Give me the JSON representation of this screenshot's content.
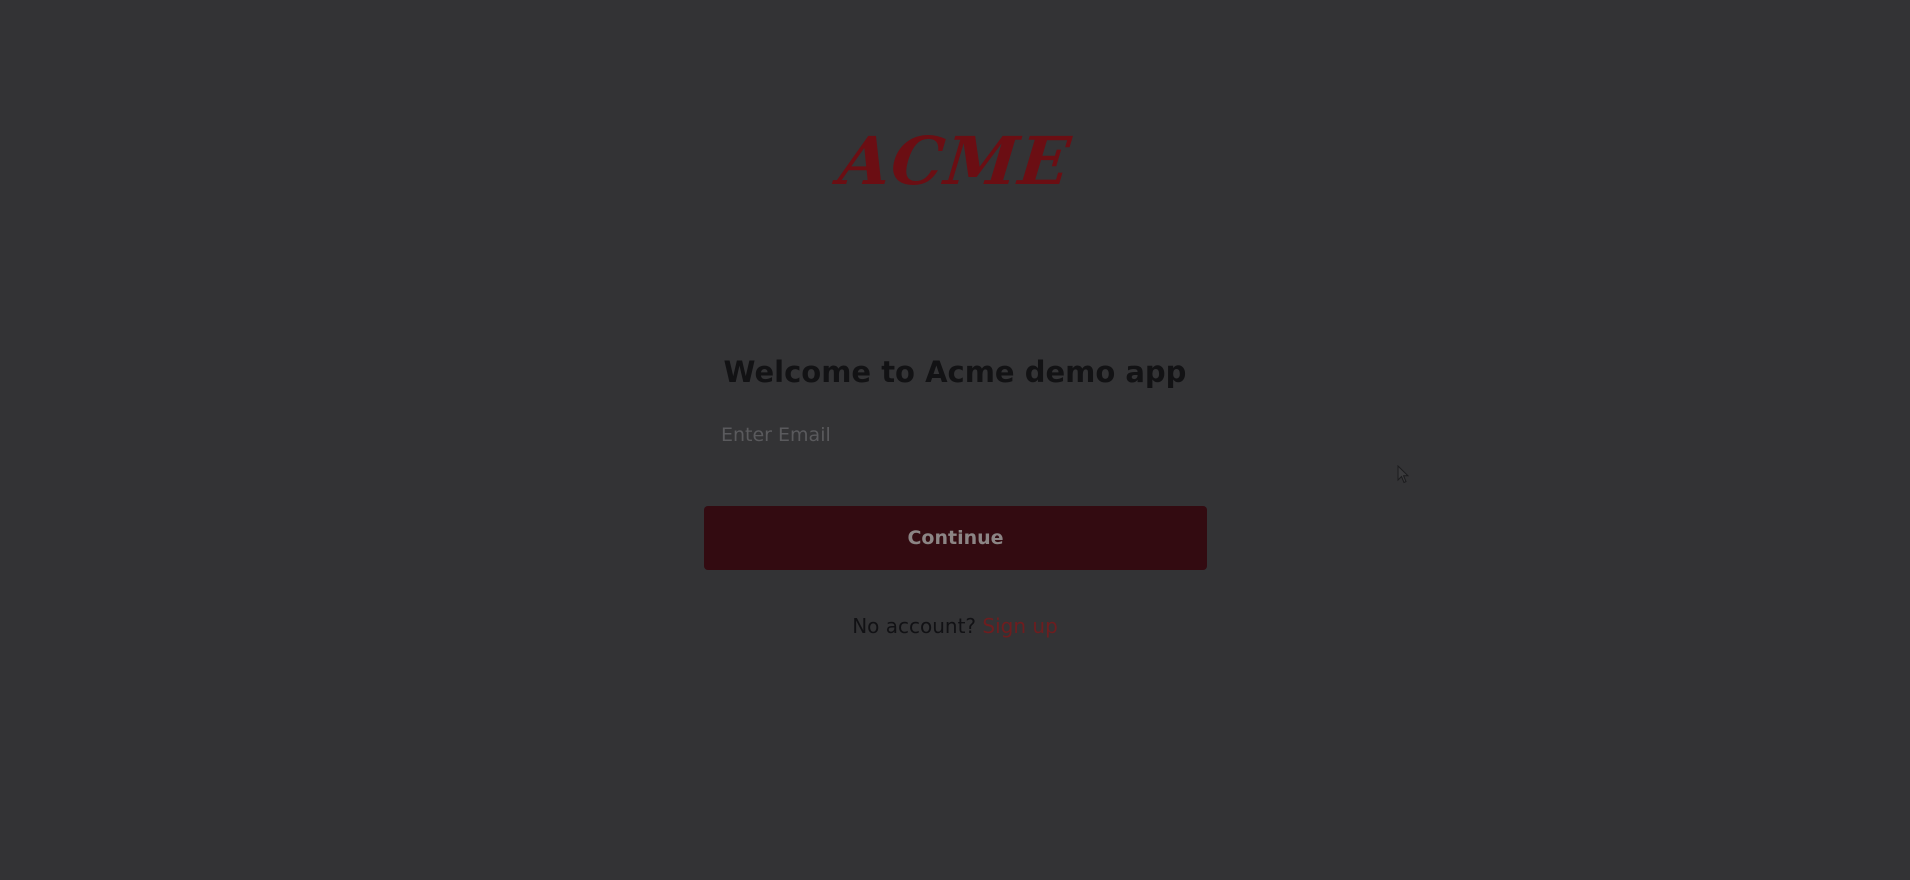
{
  "logo": {
    "text": "ACME"
  },
  "login": {
    "title": "Welcome to Acme demo app",
    "email_placeholder": "Enter Email",
    "email_value": "",
    "continue_label": "Continue",
    "no_account_text": "No account?",
    "signup_label": "Sign up"
  },
  "colors": {
    "background": "#333335",
    "brand": "#6b0e13",
    "button_background": "#330b11",
    "link": "#6e1d1f",
    "text_dark": "#121214"
  },
  "icons": {
    "cursor": "mouse-pointer-icon"
  }
}
